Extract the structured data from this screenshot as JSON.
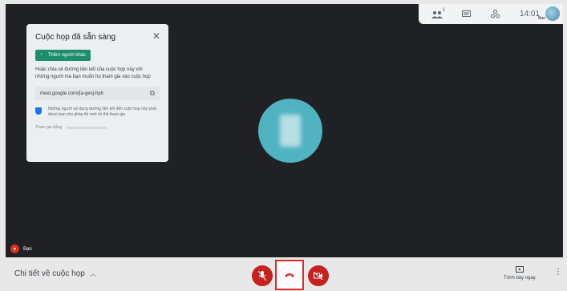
{
  "topbar": {
    "people_icon": "people-icon",
    "people_count": "1",
    "chat_icon": "chat-icon",
    "activities_icon": "activities-icon",
    "time": "14:01",
    "self_label": "Bạn"
  },
  "card": {
    "title": "Cuộc họp đã sẵn sàng",
    "close": "✕",
    "add_button": "Thêm người khác",
    "description": "Hoặc chia sẻ đường liên kết của cuộc họp này với những người mà bạn muốn họ tham gia vào cuộc họp",
    "link": "meet.google.com/jta-gexj-hph",
    "note": "Những người sử dụng đường liên kết đến cuộc họp này phải được bạn cho phép thì mới có thể tham gia",
    "joined_label": "Tham gia bằng"
  },
  "self_tile": {
    "label": "Bạn"
  },
  "bottombar": {
    "details_label": "Chi tiết về cuộc họp",
    "present_label": "Trình bày ngay"
  },
  "colors": {
    "stage": "#202124",
    "accent_green": "#1e8e6a",
    "danger": "#c5221f",
    "avatar": "#4fb3c1"
  }
}
